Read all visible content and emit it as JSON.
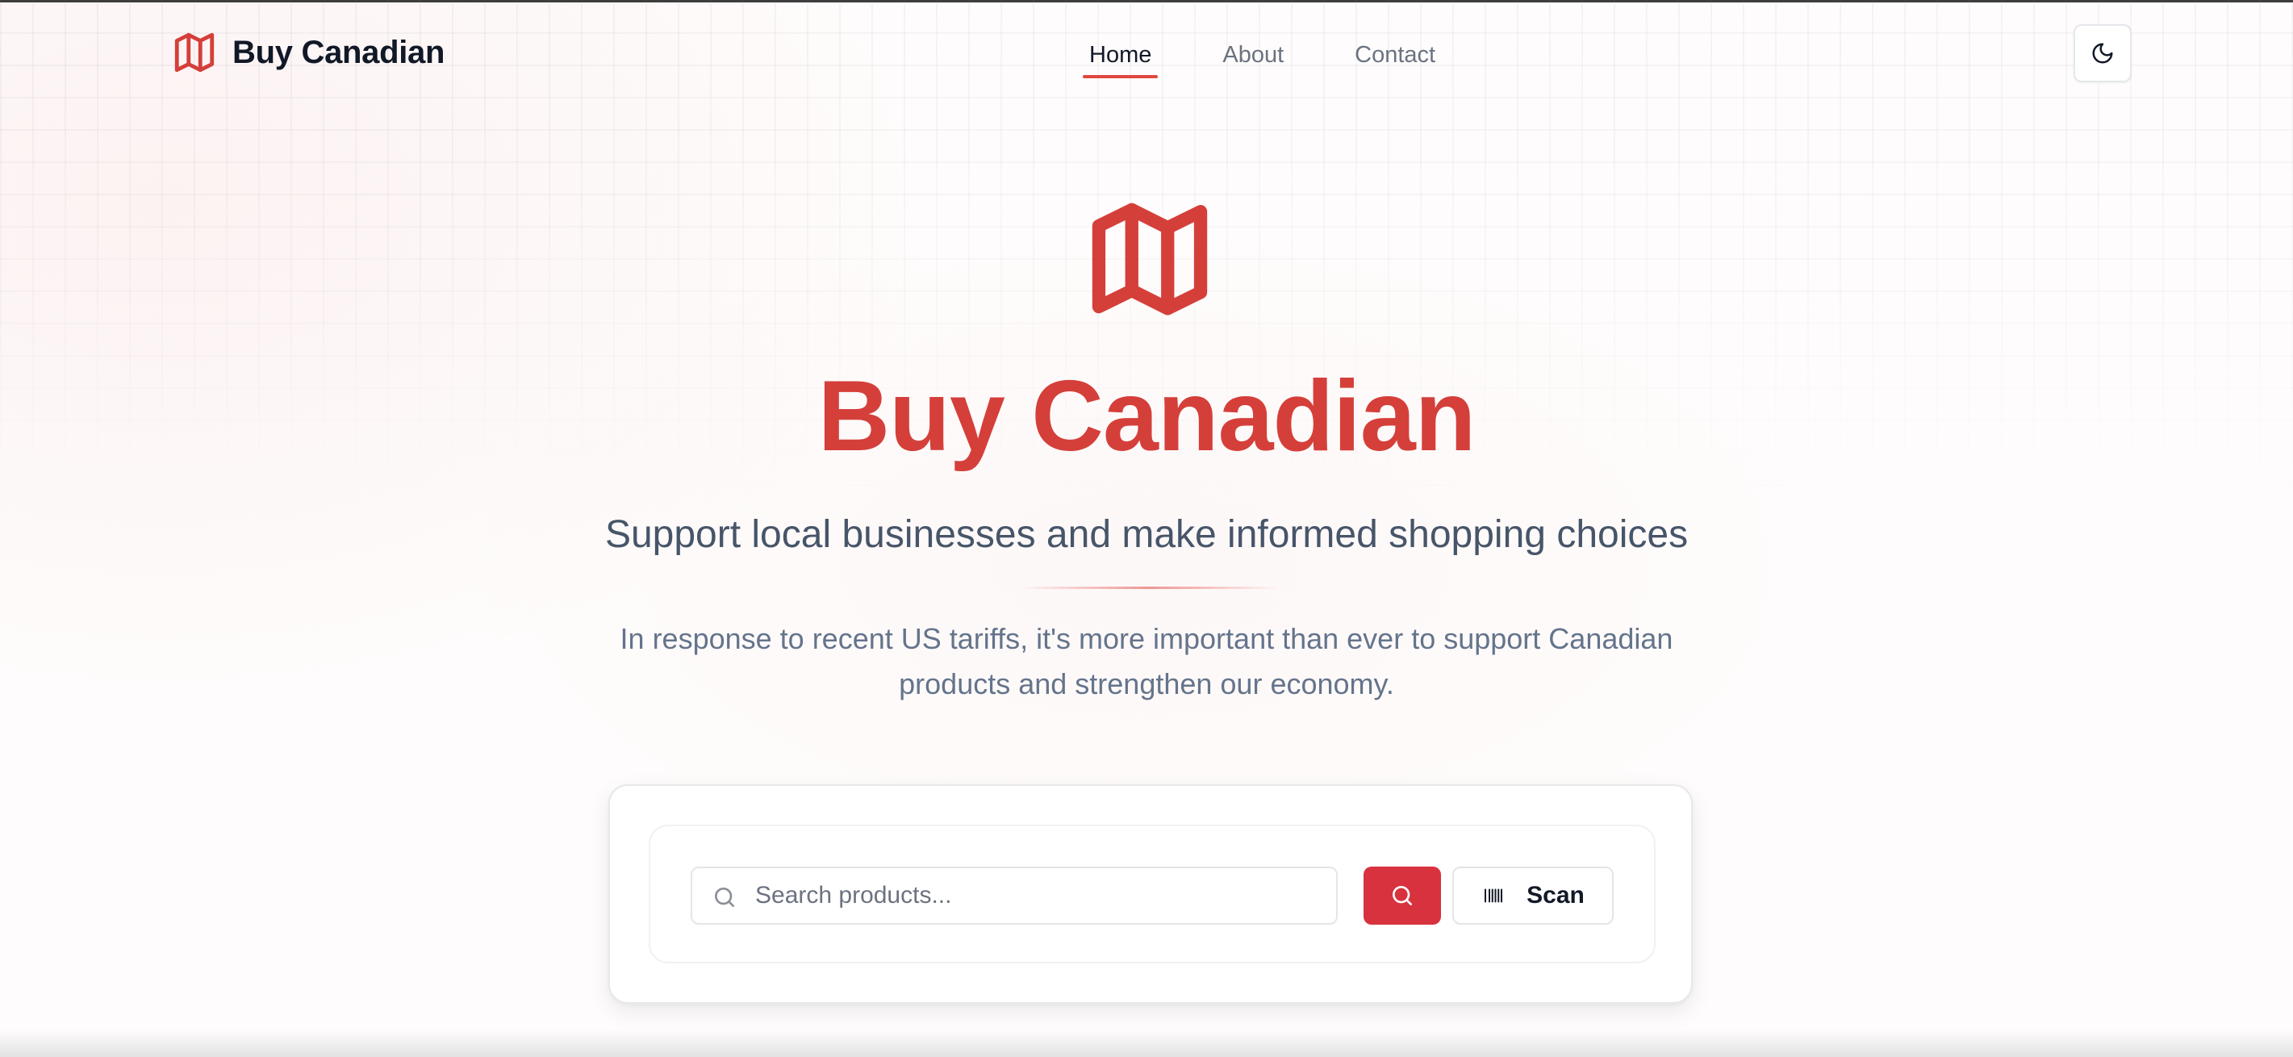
{
  "header": {
    "brand_name": "Buy Canadian",
    "brand_icon": "map-icon",
    "nav": [
      {
        "label": "Home",
        "active": true
      },
      {
        "label": "About",
        "active": false
      },
      {
        "label": "Contact",
        "active": false
      }
    ],
    "theme_toggle_icon": "moon-icon"
  },
  "hero": {
    "icon": "map-icon",
    "title": "Buy Canadian",
    "subtitle": "Support local businesses and make informed shopping choices",
    "description": "In response to recent US tariffs, it's more important than ever to support Canadian products and strengthen our economy."
  },
  "search": {
    "placeholder": "Search products...",
    "value": "",
    "search_icon": "search-icon",
    "submit_icon": "search-icon",
    "scan_icon": "barcode-icon",
    "scan_label": "Scan"
  },
  "colors": {
    "accent": "#d53f3a",
    "button": "#d7323e",
    "text_dark": "#111827",
    "text_muted": "#64748b"
  }
}
